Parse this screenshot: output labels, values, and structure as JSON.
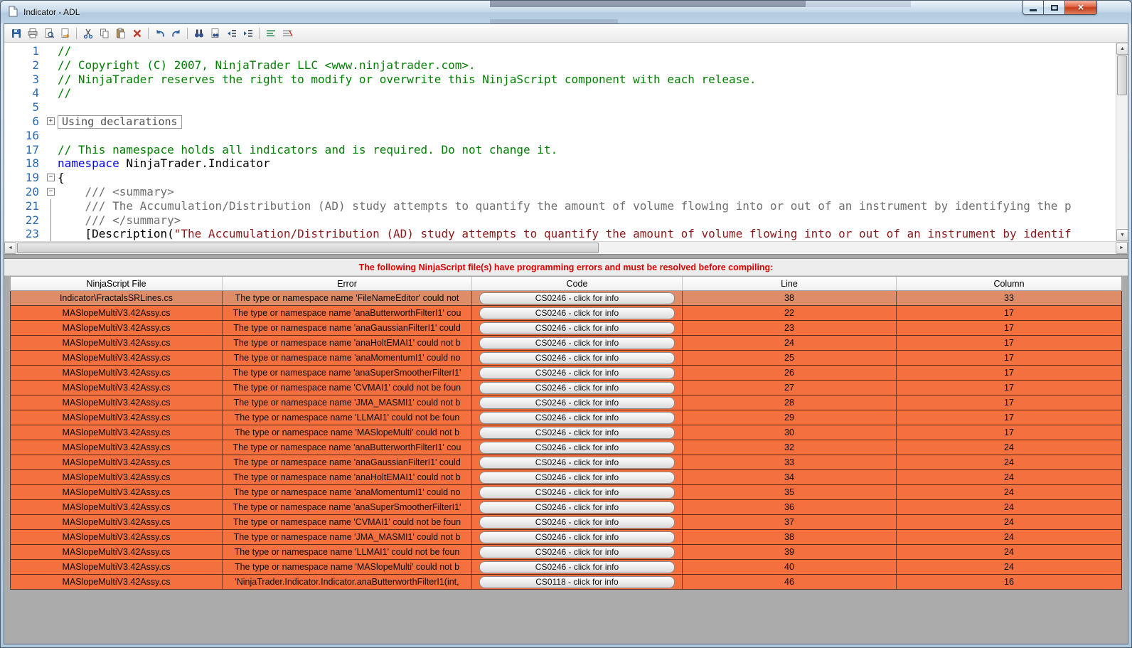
{
  "window": {
    "title": "Indicator - ADL"
  },
  "toolbar": {
    "groups": [
      {
        "icons": [
          "save",
          "print",
          "print-preview",
          "page-setup"
        ]
      },
      {
        "icons": [
          "cut",
          "copy",
          "paste",
          "delete"
        ]
      },
      {
        "icons": [
          "undo",
          "redo"
        ]
      },
      {
        "icons": [
          "find",
          "find-in-files",
          "indent-decrease",
          "indent-increase"
        ]
      },
      {
        "icons": [
          "comment-selection",
          "uncomment-selection"
        ]
      }
    ]
  },
  "editor": {
    "lines": [
      {
        "num": "1",
        "fold": "none",
        "segments": [
          {
            "t": "//",
            "c": "com"
          }
        ]
      },
      {
        "num": "2",
        "fold": "none",
        "segments": [
          {
            "t": "// Copyright (C) 2007, NinjaTrader LLC <www.ninjatrader.com>.",
            "c": "com"
          }
        ]
      },
      {
        "num": "3",
        "fold": "none",
        "segments": [
          {
            "t": "// NinjaTrader reserves the right to modify or overwrite this NinjaScript component with each release.",
            "c": "com"
          }
        ]
      },
      {
        "num": "4",
        "fold": "none",
        "segments": [
          {
            "t": "//",
            "c": "com"
          }
        ]
      },
      {
        "num": "5",
        "fold": "none",
        "segments": []
      },
      {
        "num": "6",
        "fold": "plus",
        "segments": [
          {
            "t": "Using declarations",
            "c": "collapsed"
          }
        ]
      },
      {
        "num": "16",
        "fold": "none",
        "segments": []
      },
      {
        "num": "17",
        "fold": "none",
        "segments": [
          {
            "t": "// This namespace holds all indicators and is required. Do not change it.",
            "c": "com"
          }
        ]
      },
      {
        "num": "18",
        "fold": "none",
        "segments": [
          {
            "t": "namespace",
            "c": "kw"
          },
          {
            "t": " NinjaTrader.Indicator",
            "c": "plain"
          }
        ]
      },
      {
        "num": "19",
        "fold": "minus",
        "segments": [
          {
            "t": "{",
            "c": "plain"
          }
        ]
      },
      {
        "num": "20",
        "fold": "minus",
        "segments": [
          {
            "t": "    /// <summary>",
            "c": "doc"
          }
        ]
      },
      {
        "num": "21",
        "fold": "bar",
        "segments": [
          {
            "t": "    /// The Accumulation/Distribution (AD) study attempts to quantify the amount of volume flowing into or out of an instrument by identifying the p",
            "c": "doc"
          }
        ]
      },
      {
        "num": "22",
        "fold": "bar",
        "segments": [
          {
            "t": "    /// </summary>",
            "c": "doc"
          }
        ]
      },
      {
        "num": "23",
        "fold": "bar",
        "segments": [
          {
            "t": "    [Description(",
            "c": "plain"
          },
          {
            "t": "\"The Accumulation/Distribution (AD) study attempts to quantify the amount of volume flowing into or out of an instrument by identif",
            "c": "str"
          }
        ]
      }
    ]
  },
  "error_panel": {
    "banner": "The following NinjaScript file(s) have programming errors and must be resolved before compiling:",
    "columns": [
      "NinjaScript File",
      "Error",
      "Code",
      "Line",
      "Column"
    ],
    "rows": [
      {
        "file": "Indicator\\FractalsSRLines.cs",
        "error": "The type or namespace name 'FileNameEditor' could not",
        "code": "CS0246 - click for info",
        "line": "38",
        "column": "33",
        "selected": true
      },
      {
        "file": "MASlopeMultiV3.42Assy.cs",
        "error": "The type or namespace name 'anaButterworthFilterI1' cou",
        "code": "CS0246 - click for info",
        "line": "22",
        "column": "17"
      },
      {
        "file": "MASlopeMultiV3.42Assy.cs",
        "error": "The type or namespace name 'anaGaussianFilterI1' could",
        "code": "CS0246 - click for info",
        "line": "23",
        "column": "17"
      },
      {
        "file": "MASlopeMultiV3.42Assy.cs",
        "error": "The type or namespace name 'anaHoltEMAI1' could not b",
        "code": "CS0246 - click for info",
        "line": "24",
        "column": "17"
      },
      {
        "file": "MASlopeMultiV3.42Assy.cs",
        "error": "The type or namespace name 'anaMomentumI1' could no",
        "code": "CS0246 - click for info",
        "line": "25",
        "column": "17"
      },
      {
        "file": "MASlopeMultiV3.42Assy.cs",
        "error": "The type or namespace name 'anaSuperSmootherFilterI1'",
        "code": "CS0246 - click for info",
        "line": "26",
        "column": "17"
      },
      {
        "file": "MASlopeMultiV3.42Assy.cs",
        "error": "The type or namespace name 'CVMAI1' could not be foun",
        "code": "CS0246 - click for info",
        "line": "27",
        "column": "17"
      },
      {
        "file": "MASlopeMultiV3.42Assy.cs",
        "error": "The type or namespace name 'JMA_MASMI1' could not b",
        "code": "CS0246 - click for info",
        "line": "28",
        "column": "17"
      },
      {
        "file": "MASlopeMultiV3.42Assy.cs",
        "error": "The type or namespace name 'LLMAI1' could not be foun",
        "code": "CS0246 - click for info",
        "line": "29",
        "column": "17"
      },
      {
        "file": "MASlopeMultiV3.42Assy.cs",
        "error": "The type or namespace name 'MASlopeMulti' could not b",
        "code": "CS0246 - click for info",
        "line": "30",
        "column": "17"
      },
      {
        "file": "MASlopeMultiV3.42Assy.cs",
        "error": "The type or namespace name 'anaButterworthFilterI1' cou",
        "code": "CS0246 - click for info",
        "line": "32",
        "column": "24"
      },
      {
        "file": "MASlopeMultiV3.42Assy.cs",
        "error": "The type or namespace name 'anaGaussianFilterI1' could",
        "code": "CS0246 - click for info",
        "line": "33",
        "column": "24"
      },
      {
        "file": "MASlopeMultiV3.42Assy.cs",
        "error": "The type or namespace name 'anaHoltEMAI1' could not b",
        "code": "CS0246 - click for info",
        "line": "34",
        "column": "24"
      },
      {
        "file": "MASlopeMultiV3.42Assy.cs",
        "error": "The type or namespace name 'anaMomentumI1' could no",
        "code": "CS0246 - click for info",
        "line": "35",
        "column": "24"
      },
      {
        "file": "MASlopeMultiV3.42Assy.cs",
        "error": "The type or namespace name 'anaSuperSmootherFilterI1'",
        "code": "CS0246 - click for info",
        "line": "36",
        "column": "24"
      },
      {
        "file": "MASlopeMultiV3.42Assy.cs",
        "error": "The type or namespace name 'CVMAI1' could not be foun",
        "code": "CS0246 - click for info",
        "line": "37",
        "column": "24"
      },
      {
        "file": "MASlopeMultiV3.42Assy.cs",
        "error": "The type or namespace name 'JMA_MASMI1' could not b",
        "code": "CS0246 - click for info",
        "line": "38",
        "column": "24"
      },
      {
        "file": "MASlopeMultiV3.42Assy.cs",
        "error": "The type or namespace name 'LLMAI1' could not be foun",
        "code": "CS0246 - click for info",
        "line": "39",
        "column": "24"
      },
      {
        "file": "MASlopeMultiV3.42Assy.cs",
        "error": "The type or namespace name 'MASlopeMulti' could not b",
        "code": "CS0246 - click for info",
        "line": "40",
        "column": "24"
      },
      {
        "file": "MASlopeMultiV3.42Assy.cs",
        "error": "'NinjaTrader.Indicator.Indicator.anaButterworthFilterI1(int,",
        "code": "CS0118 - click for info",
        "line": "46",
        "column": "16"
      }
    ]
  }
}
